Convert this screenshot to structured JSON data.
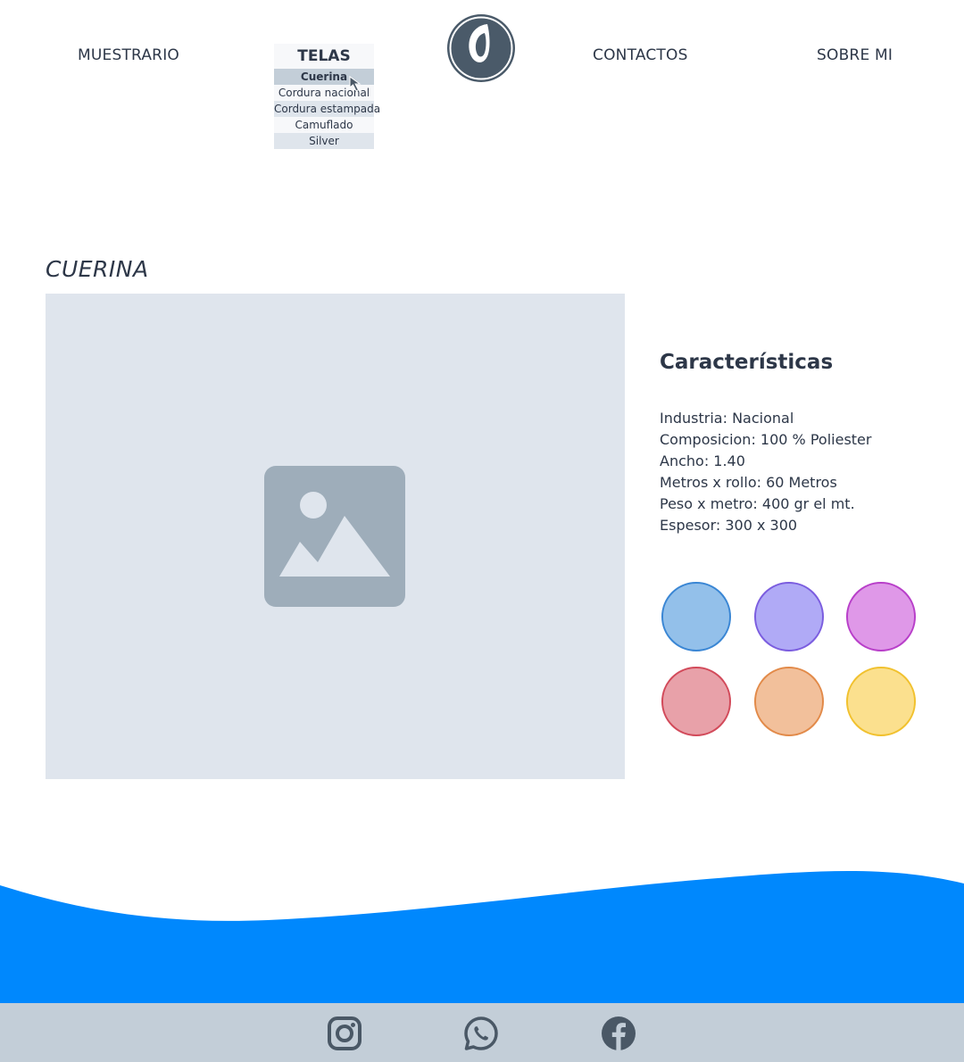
{
  "nav": {
    "muestrario": "MUESTRARIO",
    "contactos": "CONTACTOS",
    "sobre_mi": "SOBRE MI"
  },
  "telas_menu": {
    "title": "TELAS",
    "items": [
      {
        "label": "Cuerina",
        "active": true
      },
      {
        "label": "Cordura nacional"
      },
      {
        "label": "Cordura estampada"
      },
      {
        "label": "Camuflado"
      },
      {
        "label": "Silver"
      }
    ]
  },
  "logo": {
    "icon": "logo-icon",
    "color": "#4a5a69"
  },
  "page": {
    "title": "CUERINA"
  },
  "image": {
    "icon": "image-placeholder-icon"
  },
  "characteristics": {
    "title": "Características",
    "lines": [
      "Industria: Nacional",
      "Composicion: 100 % Poliester",
      "Ancho: 1.40",
      "Metros x rollo: 60 Metros",
      "Peso x metro: 400 gr el mt.",
      "Espesor: 300 x 300"
    ]
  },
  "swatches": [
    {
      "name": "blue",
      "fill": "#93c0ea",
      "border": "#3a86d4"
    },
    {
      "name": "purple",
      "fill": "#b0aaf6",
      "border": "#7b5ddf"
    },
    {
      "name": "magenta",
      "fill": "#df98e8",
      "border": "#b83fc9"
    },
    {
      "name": "red",
      "fill": "#e8a1a9",
      "border": "#d24a5a"
    },
    {
      "name": "orange",
      "fill": "#f2c09b",
      "border": "#e28a49"
    },
    {
      "name": "yellow",
      "fill": "#fbe08e",
      "border": "#f1c12e"
    }
  ],
  "colors": {
    "wave": "#0088fd",
    "footer": "#c3ced8",
    "icon": "#4a5866"
  },
  "social": [
    {
      "name": "instagram-icon"
    },
    {
      "name": "whatsapp-icon"
    },
    {
      "name": "facebook-icon"
    }
  ]
}
